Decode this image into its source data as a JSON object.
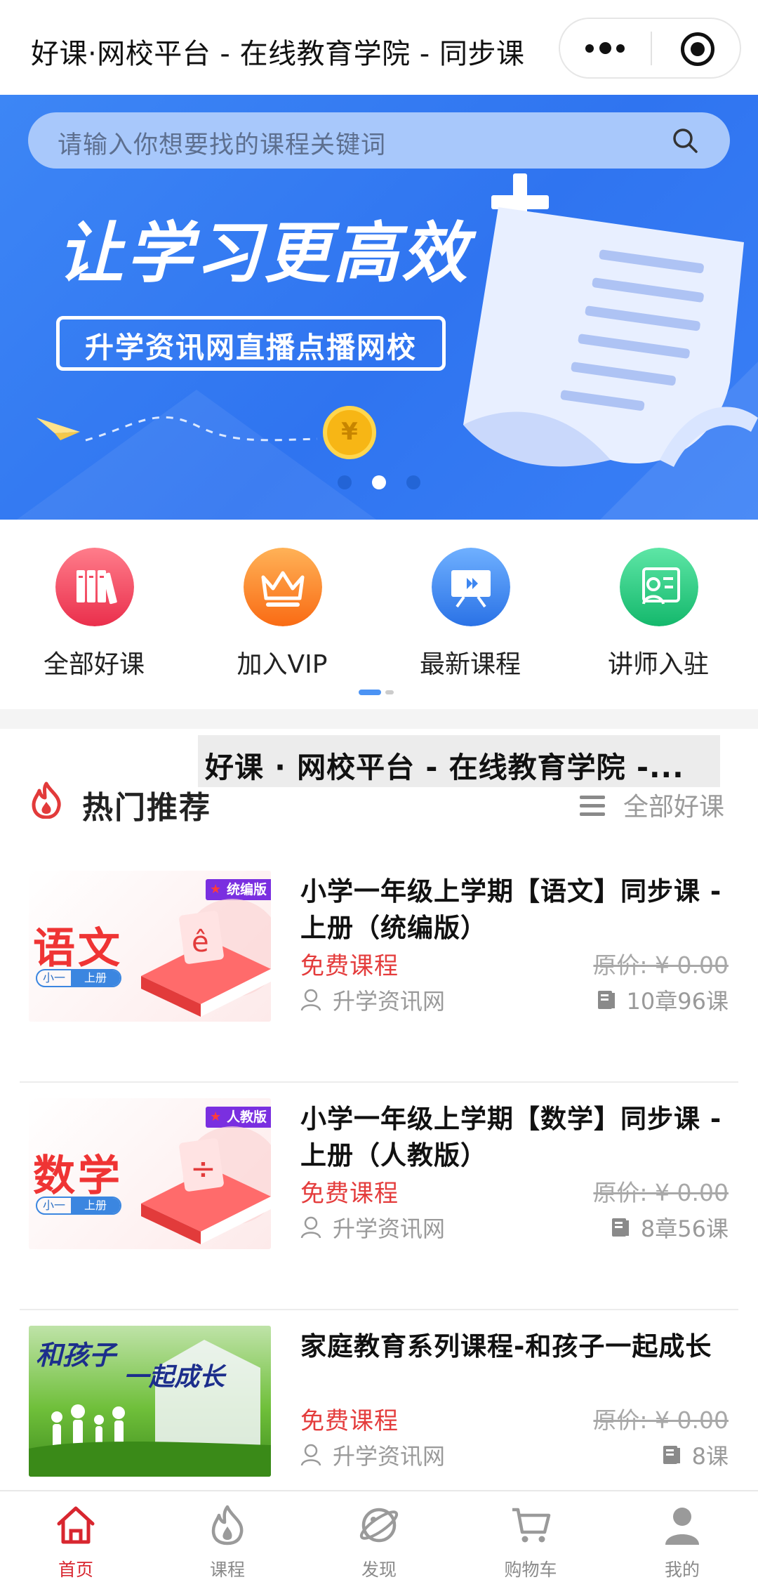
{
  "nav": {
    "title": "好课·网校平台 - 在线教育学院 - 同步课",
    "more_icon": "more-dots-icon",
    "close_icon": "miniprogram-close-icon"
  },
  "banner": {
    "search_placeholder": "请输入你想要找的课程关键词",
    "headline": "让学习更高效",
    "subline": "升学资讯网直播点播网校",
    "coin_symbol": "¥",
    "page_count": 3,
    "active_page": 2,
    "accent_color": "#2f74f0"
  },
  "menu": {
    "items": [
      {
        "label": "全部好课",
        "icon": "books-icon",
        "color": "#f2475c"
      },
      {
        "label": "加入VIP",
        "icon": "crown-icon",
        "color": "#fb8a2b"
      },
      {
        "label": "最新课程",
        "icon": "presentation-icon",
        "color": "#3f8ff2"
      },
      {
        "label": "讲师入驻",
        "icon": "teacher-icon",
        "color": "#2fcf86"
      }
    ]
  },
  "overlay_text": "好课 · 网校平台 - 在线教育学院 -...",
  "section": {
    "title": "热门推荐",
    "more_label": "全部好课"
  },
  "courses": [
    {
      "title": "小学一年级上学期【语文】同步课 - 上册（统编版）",
      "price_label": "免费课程",
      "original_price": "原价: ¥ 0.00",
      "author": "升学资讯网",
      "meta": "10章96课",
      "thumb": {
        "subject": "语文",
        "tag": "统编版",
        "grade1": "小一",
        "grade2": "上册",
        "symbol": "ê"
      }
    },
    {
      "title": "小学一年级上学期【数学】同步课 - 上册（人教版）",
      "price_label": "免费课程",
      "original_price": "原价: ¥ 0.00",
      "author": "升学资讯网",
      "meta": "8章56课",
      "thumb": {
        "subject": "数学",
        "tag": "人教版",
        "grade1": "小一",
        "grade2": "上册",
        "symbol": "÷"
      }
    },
    {
      "title": "家庭教育系列课程-和孩子一起成长",
      "price_label": "免费课程",
      "original_price": "原价: ¥ 0.00",
      "author": "升学资讯网",
      "meta": "8课",
      "thumb": {
        "caption1": "和孩子",
        "caption2": "一起成长"
      }
    }
  ],
  "tabbar": {
    "items": [
      {
        "label": "首页",
        "icon": "home-icon",
        "active": true
      },
      {
        "label": "课程",
        "icon": "flame-icon",
        "active": false
      },
      {
        "label": "发现",
        "icon": "planet-icon",
        "active": false
      },
      {
        "label": "购物车",
        "icon": "cart-icon",
        "active": false
      },
      {
        "label": "我的",
        "icon": "user-icon",
        "active": false
      }
    ],
    "active_color": "#d8262f"
  }
}
